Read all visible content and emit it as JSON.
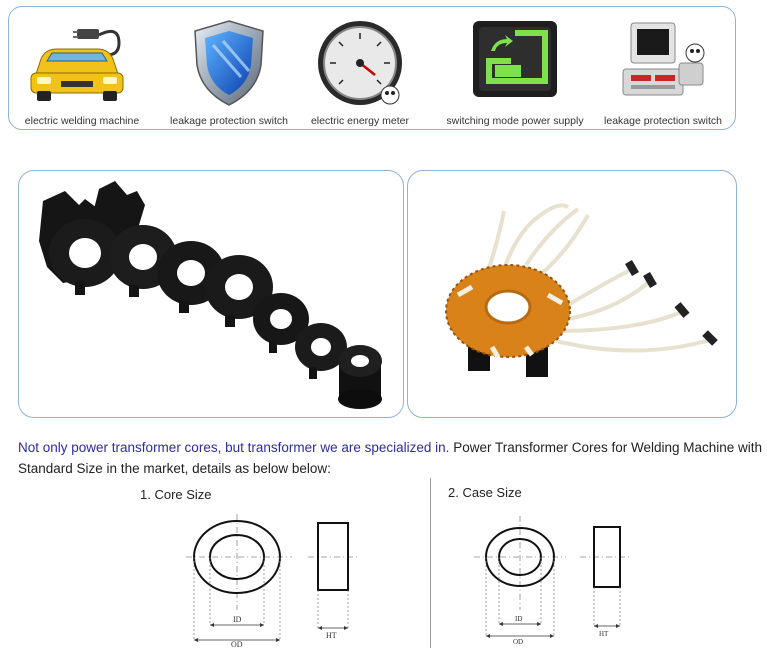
{
  "applications": [
    {
      "icon": "car-plug-icon",
      "label": "electric welding machine"
    },
    {
      "icon": "shield-icon",
      "label": "leakage protection switch"
    },
    {
      "icon": "meter-gauge-icon",
      "label": "electric energy meter"
    },
    {
      "icon": "power-supply-icon",
      "label": "switching mode power supply"
    },
    {
      "icon": "computer-switch-icon",
      "label": "leakage protection switch"
    }
  ],
  "intro": {
    "highlight": "Not only power transformer cores, but transformer we are specialized in.",
    "rest": " Power Transformer Cores for Welding Machine with Standard Size in the market, details as below below:"
  },
  "sections": {
    "core": {
      "title": "1. Core Size"
    },
    "case": {
      "title": "2. Case Size"
    }
  },
  "dims": {
    "id": "ID",
    "od": "OD",
    "ht": "HT"
  },
  "colors": {
    "border": "#8fb3d6",
    "highlight": "#2c2ca8",
    "core": "#1a1a1a",
    "copper": "#d9821a"
  }
}
